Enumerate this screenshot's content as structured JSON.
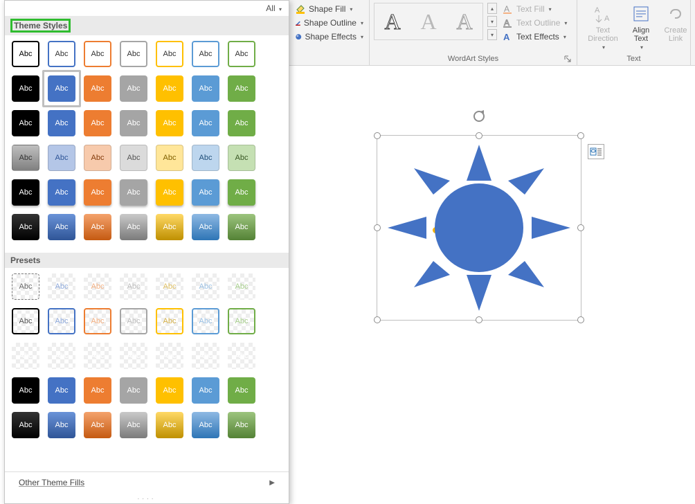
{
  "ribbon": {
    "shape_fill": "Shape Fill",
    "shape_outline": "Shape Outline",
    "shape_effects": "Shape Effects",
    "wordart_label": "WordArt Styles",
    "text_fill": "Text Fill",
    "text_outline": "Text Outline",
    "text_effects": "Text Effects",
    "text_direction": "Text Direction",
    "align_text": "Align Text",
    "create_link": "Create Link",
    "text_group": "Text",
    "wordart_samples": [
      "A",
      "A",
      "A"
    ]
  },
  "panel": {
    "filter_label": "All",
    "section_theme": "Theme Styles",
    "section_presets": "Presets",
    "other_fills": "Other Theme Fills",
    "swatch_text": "Abc",
    "colors": {
      "accent1": "#000000",
      "accent2": "#4472c4",
      "accent3": "#ed7d31",
      "accent4": "#a5a5a5",
      "accent5": "#ffc000",
      "accent6": "#5b9bd5",
      "accent7": "#70ad47",
      "light1": "#808080",
      "light2": "#b4c6e7",
      "light3": "#f7caac",
      "light4": "#dbdbdb",
      "light5": "#ffe699",
      "light6": "#bdd6ee",
      "light7": "#c5e0b3"
    }
  },
  "canvas": {
    "shape_type": "sun",
    "shape_fill": "#4472c4"
  }
}
